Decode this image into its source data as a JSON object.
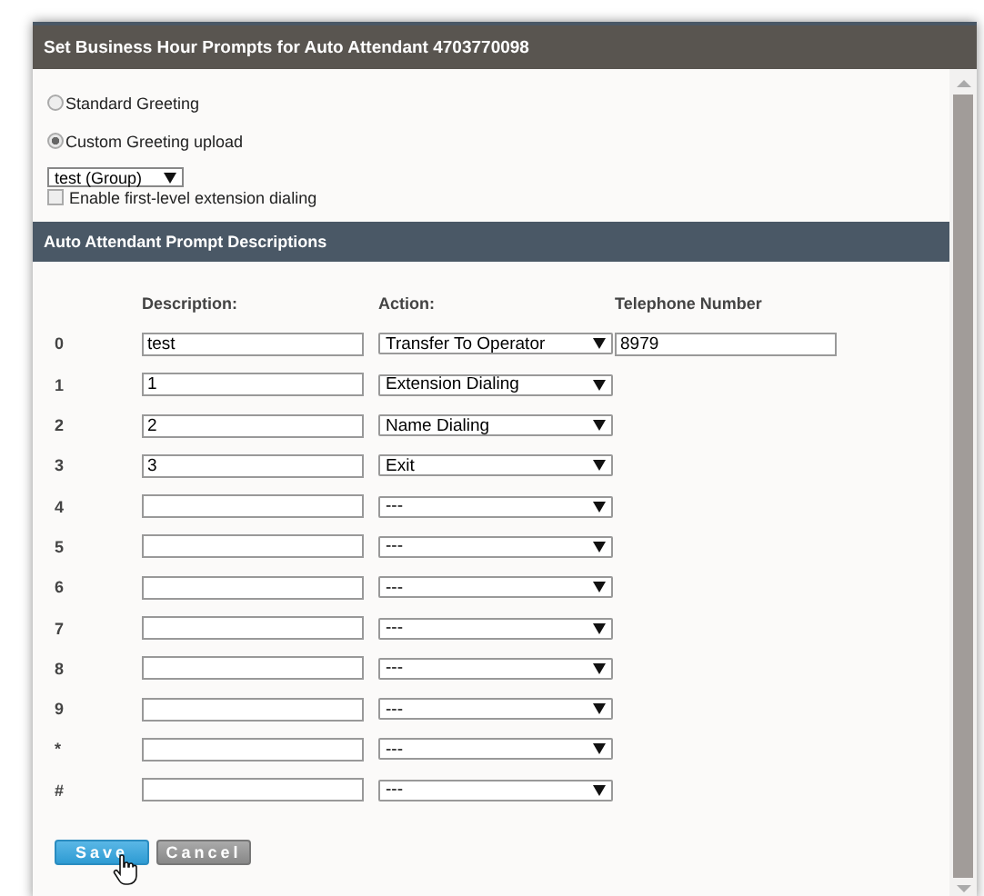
{
  "window": {
    "title": "Set Business Hour Prompts for Auto Attendant 4703770098"
  },
  "greetings": [
    {
      "label": "Standard Greeting",
      "selected": false
    },
    {
      "label": "Custom Greeting upload",
      "selected": true
    }
  ],
  "greeting_file": {
    "value": "test (Group)"
  },
  "first_level_dialing": {
    "label": "Enable first-level extension dialing",
    "checked": false
  },
  "section": {
    "title": "Auto Attendant Prompt Descriptions"
  },
  "columns": [
    "Description:",
    "Action:",
    "Telephone Number"
  ],
  "rows": [
    {
      "key": "0",
      "description": "test",
      "action": "Transfer To Operator",
      "phone": "8979"
    },
    {
      "key": "1",
      "description": "1",
      "action": "Extension Dialing"
    },
    {
      "key": "2",
      "description": "2",
      "action": "Name Dialing"
    },
    {
      "key": "3",
      "description": "3",
      "action": "Exit"
    },
    {
      "key": "4",
      "description": "",
      "action": "---"
    },
    {
      "key": "5",
      "description": "",
      "action": "---"
    },
    {
      "key": "6",
      "description": "",
      "action": "---"
    },
    {
      "key": "7",
      "description": "",
      "action": "---"
    },
    {
      "key": "8",
      "description": "",
      "action": "---"
    },
    {
      "key": "9",
      "description": "",
      "action": "---"
    },
    {
      "key": "*",
      "description": "",
      "action": "---"
    },
    {
      "key": "#",
      "description": "",
      "action": "---"
    }
  ],
  "buttons": [
    {
      "label": "Save",
      "kind": "primary"
    },
    {
      "label": "Cancel",
      "kind": "secondary"
    }
  ]
}
